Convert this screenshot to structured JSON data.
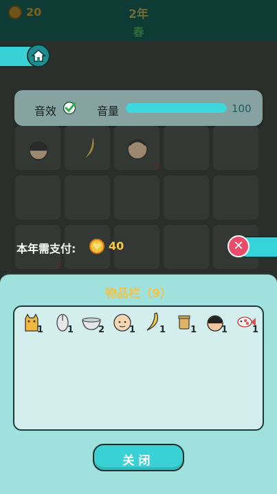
{
  "header": {
    "coins": "20",
    "year": "2年",
    "season": "春"
  },
  "settings": {
    "sfx_label": "音效",
    "sfx_enabled": true,
    "volume_label": "音量",
    "volume_value": "100",
    "volume_level": 1.0
  },
  "background_grid": {
    "counts": [
      "3",
      "2"
    ]
  },
  "payment": {
    "label": "本年需支付:",
    "amount": "40"
  },
  "inventory": {
    "title": "物品栏（9）",
    "items": [
      {
        "icon": "cat-icon",
        "count": "1"
      },
      {
        "icon": "mouse-icon",
        "count": "1"
      },
      {
        "icon": "bowl-icon",
        "count": "2"
      },
      {
        "icon": "bald-man-icon",
        "count": "1"
      },
      {
        "icon": "banana-icon",
        "count": "1"
      },
      {
        "icon": "jar-icon",
        "count": "1"
      },
      {
        "icon": "thief-icon",
        "count": "1"
      },
      {
        "icon": "fish-icon",
        "count": "1"
      }
    ],
    "close_label": "关闭"
  },
  "colors": {
    "accent": "#3ad1d5",
    "gold": "#f5c24a",
    "panel": "#9fe1dd"
  }
}
